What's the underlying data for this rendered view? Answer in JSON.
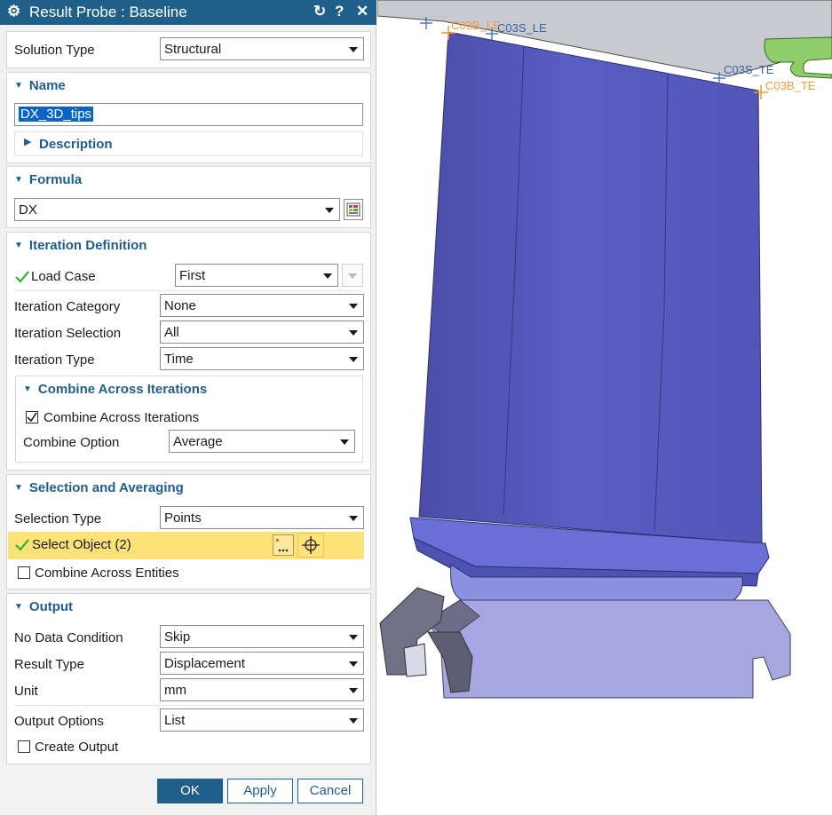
{
  "title": "Result Probe : Baseline",
  "titlebar_icons": [
    "gear-icon",
    "reset-icon",
    "help-icon",
    "close-icon"
  ],
  "solution": {
    "label": "Solution Type",
    "value": "Structural"
  },
  "name_section": {
    "header": "Name",
    "value": "DX_3D_tips",
    "description_header": "Description"
  },
  "formula_section": {
    "header": "Formula",
    "value": "DX"
  },
  "iteration": {
    "header": "Iteration Definition",
    "load_case_label": "Load Case",
    "load_case_value": "First",
    "category_label": "Iteration Category",
    "category_value": "None",
    "selection_label": "Iteration Selection",
    "selection_value": "All",
    "type_label": "Iteration Type",
    "type_value": "Time",
    "combine_header": "Combine Across Iterations",
    "combine_checkbox_label": "Combine Across Iterations",
    "combine_checked": true,
    "combine_option_label": "Combine Option",
    "combine_option_value": "Average"
  },
  "selection": {
    "header": "Selection and Averaging",
    "type_label": "Selection Type",
    "type_value": "Points",
    "select_object_label": "Select Object (2)",
    "combine_entities_label": "Combine Across Entities",
    "combine_entities_checked": false
  },
  "output": {
    "header": "Output",
    "no_data_label": "No Data Condition",
    "no_data_value": "Skip",
    "result_type_label": "Result Type",
    "result_type_value": "Displacement",
    "unit_label": "Unit",
    "unit_value": "mm",
    "options_label": "Output Options",
    "options_value": "List",
    "create_output_label": "Create Output",
    "create_output_checked": false
  },
  "buttons": {
    "ok": "OK",
    "apply": "Apply",
    "cancel": "Cancel"
  },
  "viewport": {
    "labels": {
      "le_orange": "C03B_LE",
      "le_blue": "C03S_LE",
      "te_blue": "C03S_TE",
      "te_orange": "C03B_TE"
    }
  },
  "colors": {
    "accent": "#1f5f8a",
    "highlight": "#fde27a",
    "blade": "#5558b8",
    "check": "#2fb52f",
    "orange": "#f39c3a"
  }
}
